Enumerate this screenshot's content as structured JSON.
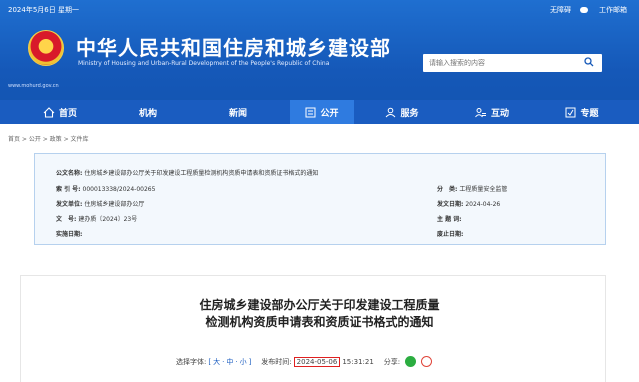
{
  "top_strip": {
    "date_text": "2024年5月6日 星期一",
    "links": [
      "无障碍",
      "工作邮箱"
    ]
  },
  "header": {
    "title_cn": "中华人民共和国住房和城乡建设部",
    "title_en": "Ministry of Housing and Urban-Rural Development of the People's Republic of China",
    "site_url": "www.mohurd.gov.cn",
    "search_placeholder": "请输入搜索的内容"
  },
  "nav": {
    "items": [
      {
        "label": "首页",
        "icon": "home-icon"
      },
      {
        "label": "机构",
        "icon": ""
      },
      {
        "label": "新闻",
        "icon": ""
      },
      {
        "label": "公开",
        "icon": "document-icon"
      },
      {
        "label": "服务",
        "icon": "person-icon"
      },
      {
        "label": "互动",
        "icon": "people-icon"
      },
      {
        "label": "专题",
        "icon": "badge-icon"
      }
    ],
    "active_index": 3
  },
  "breadcrumb": "首页 > 公开 > 政策 > 文件库",
  "info": {
    "doc_name_label": "公文名称:",
    "doc_name": "住房城乡建设部办公厅关于印发建设工程质量检测机构资质申请表和资质证书格式的通知",
    "index_label": "索 引 号:",
    "index": "000013338/2024-00265",
    "category_label": "分　类:",
    "category": "工程质量安全监管",
    "issuer_label": "发文单位:",
    "issuer": "住房城乡建设部办公厅",
    "issue_date_label": "发文日期:",
    "issue_date": "2024-04-26",
    "doc_no_label": "文　号:",
    "doc_no": "建办质〔2024〕23号",
    "subject_label": "主 题 词:",
    "subject": "",
    "effective_label": "实施日期:",
    "effective": "",
    "expiry_label": "废止日期:",
    "expiry": ""
  },
  "article": {
    "title_line1": "住房城乡建设部办公厅关于印发建设工程质量",
    "title_line2": "检测机构资质申请表和资质证书格式的通知",
    "font_label": "选择字体:",
    "font_sizes": [
      "[",
      "大",
      "·",
      "中",
      "·",
      "小",
      "]"
    ],
    "publish_label": "发布时间:",
    "publish_date": "2024-05-06",
    "publish_time": "15:31:21",
    "share_label": "分享:"
  },
  "colors": {
    "brand_blue": "#1558b8",
    "nav_active": "#2f7be0",
    "highlight_red": "#e02020",
    "wechat_green": "#2bad40",
    "weibo_red": "#e0453a"
  }
}
